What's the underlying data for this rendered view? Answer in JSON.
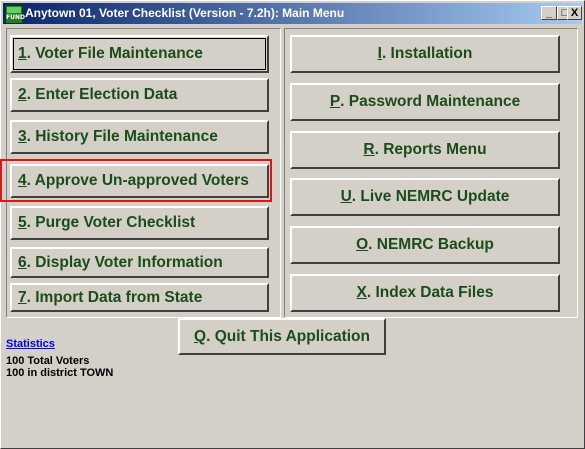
{
  "window": {
    "title": "Anytown 01, Voter Checklist (Version - 7.2h):  Main Menu",
    "icon_label": "FUND",
    "controls": {
      "minimize": "_",
      "maximize": "□",
      "close": "X"
    }
  },
  "left_menu": [
    {
      "key": "1",
      "label": ". Voter File Maintenance"
    },
    {
      "key": "2",
      "label": ". Enter Election Data"
    },
    {
      "key": "3",
      "label": ". History File Maintenance"
    },
    {
      "key": "4",
      "label": ". Approve Un-approved Voters"
    },
    {
      "key": "5",
      "label": ". Purge Voter Checklist"
    },
    {
      "key": "6",
      "label": ". Display Voter Information"
    },
    {
      "key": "7",
      "label": ". Import Data from State"
    }
  ],
  "right_menu": [
    {
      "key": "I",
      "label": ". Installation"
    },
    {
      "key": "P",
      "label": ". Password Maintenance"
    },
    {
      "key": "R",
      "label": ". Reports Menu"
    },
    {
      "key": "U",
      "label": ". Live NEMRC Update"
    },
    {
      "key": "O",
      "label": ". NEMRC Backup"
    },
    {
      "key": "X",
      "label": ". Index Data Files"
    }
  ],
  "quit": {
    "key": "Q",
    "label": ". Quit This Application"
  },
  "statistics": {
    "link": "Statistics",
    "lines": [
      "100 Total Voters",
      "100 in district TOWN"
    ]
  },
  "colors": {
    "button_text": "#1a4d1a",
    "highlight": "#e01515",
    "link": "#0000ee"
  }
}
